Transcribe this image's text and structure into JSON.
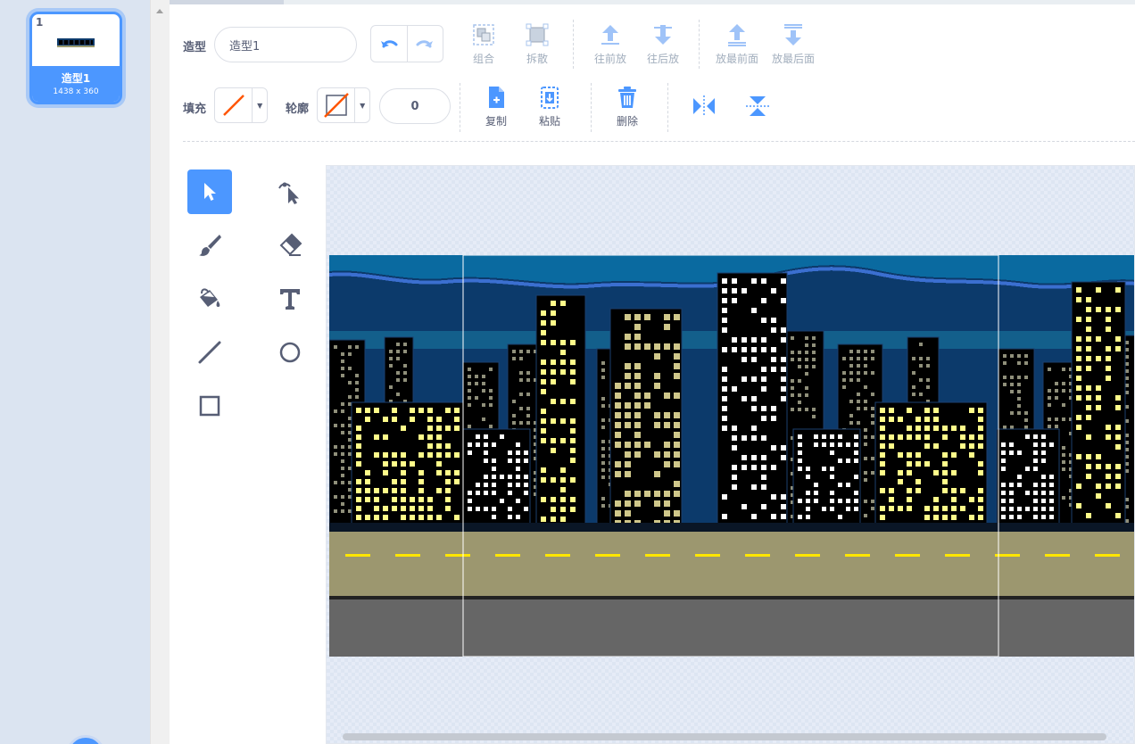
{
  "costumes": [
    {
      "number": "1",
      "name": "造型1",
      "size": "1438 x 360"
    }
  ],
  "toolbar": {
    "costume_label": "造型",
    "costume_name": "造型1",
    "group_label": "组合",
    "ungroup_label": "拆散",
    "forward_label": "往前放",
    "backward_label": "往后放",
    "front_label": "放最前面",
    "back_label": "放最后面",
    "fill_label": "填充",
    "outline_label": "轮廓",
    "outline_width": "0",
    "copy_label": "复制",
    "paste_label": "粘贴",
    "delete_label": "删除"
  },
  "icons": {
    "undo": "undo-icon",
    "redo": "redo-icon",
    "group": "group-icon",
    "ungroup": "ungroup-icon",
    "forward": "forward-icon",
    "backward": "backward-icon",
    "front": "front-icon",
    "back": "back-icon",
    "copy": "copy-icon",
    "paste": "paste-icon",
    "delete": "trash-icon",
    "flip_h": "flip-horizontal-icon",
    "flip_v": "flip-vertical-icon"
  },
  "tools": [
    "select",
    "reshape",
    "brush",
    "eraser",
    "fill",
    "text",
    "line",
    "circle",
    "rectangle"
  ],
  "active_tool": "select",
  "colors": {
    "accent": "#4c97ff",
    "text": "#575e75",
    "disabled": "#a2aebd",
    "no_color_slash": "#ff5500"
  }
}
